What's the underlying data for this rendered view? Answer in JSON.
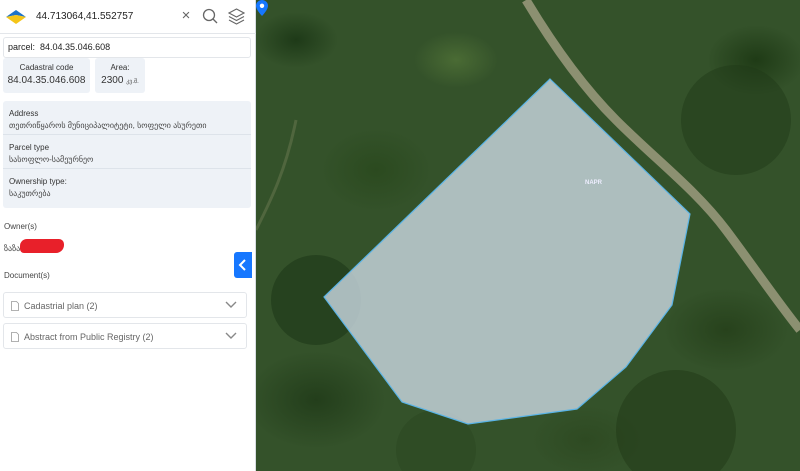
{
  "search": {
    "value": "44.713064,41.552757"
  },
  "parcel_field": {
    "prefix": "parcel:",
    "value": "84.04.35.046.608"
  },
  "cards": {
    "cadastral": {
      "label": "Cadastral code",
      "value": "84.04.35.046.608"
    },
    "area": {
      "label": "Area:",
      "value": "2300",
      "unit": "კვ.მ."
    }
  },
  "info": {
    "address": {
      "label": "Address",
      "value": "თეთრიწყაროს მუნიციპალიტეტი, სოფელი ასურეთი"
    },
    "parcel_type": {
      "label": "Parcel type",
      "value": "სასოფლო-სამეურნეო"
    },
    "ownership": {
      "label": "Ownership type:",
      "value": "საკუთრება"
    }
  },
  "owners": {
    "title": "Owner(s)",
    "name_prefix": "ზაზა"
  },
  "documents": {
    "title": "Document(s)",
    "items": [
      {
        "label": "Cadastrial plan (2)"
      },
      {
        "label": "Abstract from Public Registry (2)"
      }
    ]
  },
  "map": {
    "watermark": "NAPR"
  },
  "colors": {
    "accent": "#1677ff",
    "parcel_outline": "#5ab4e6",
    "parcel_fill": "#c8d6df"
  },
  "icons": [
    "logo-icon",
    "close-icon",
    "search-icon",
    "layers-icon",
    "document-icon",
    "chevron-down-icon",
    "chevron-left-icon",
    "map-pin-icon"
  ]
}
